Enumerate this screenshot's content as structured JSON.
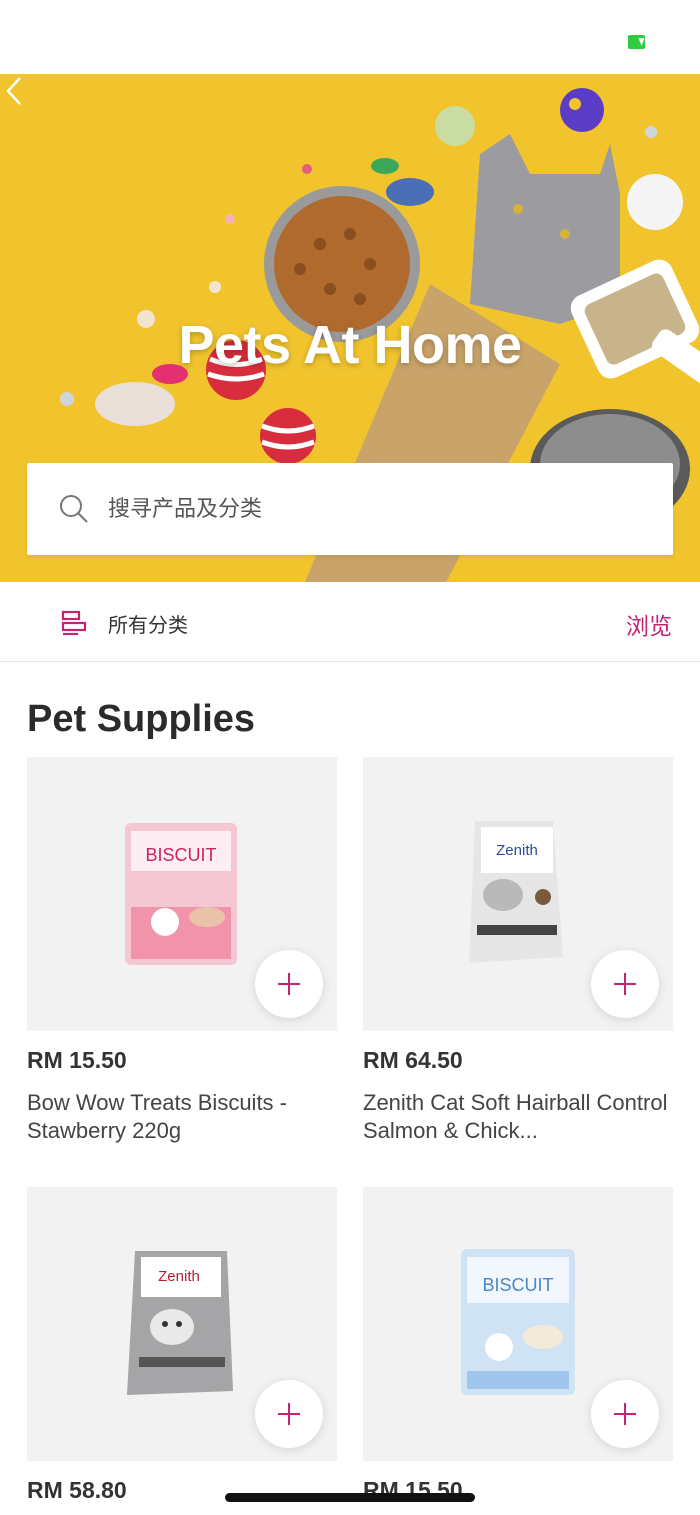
{
  "hero": {
    "title": "Pets At Home"
  },
  "search": {
    "placeholder": "搜寻产品及分类"
  },
  "category_bar": {
    "label": "所有分类",
    "browse": "浏览"
  },
  "section": {
    "title": "Pet Supplies"
  },
  "products": [
    {
      "price": "RM 15.50",
      "name": "Bow Wow Treats Biscuits - Stawberry 220g"
    },
    {
      "price": "RM 64.50",
      "name": "Zenith Cat Soft Hairball Control Salmon & Chick..."
    },
    {
      "price": "RM 58.80",
      "name": ""
    },
    {
      "price": "RM 15.50",
      "name": ""
    }
  ],
  "colors": {
    "accent": "#c4236f",
    "hero_bg": "#f1c42d",
    "card_bg": "#f2f2f2"
  }
}
